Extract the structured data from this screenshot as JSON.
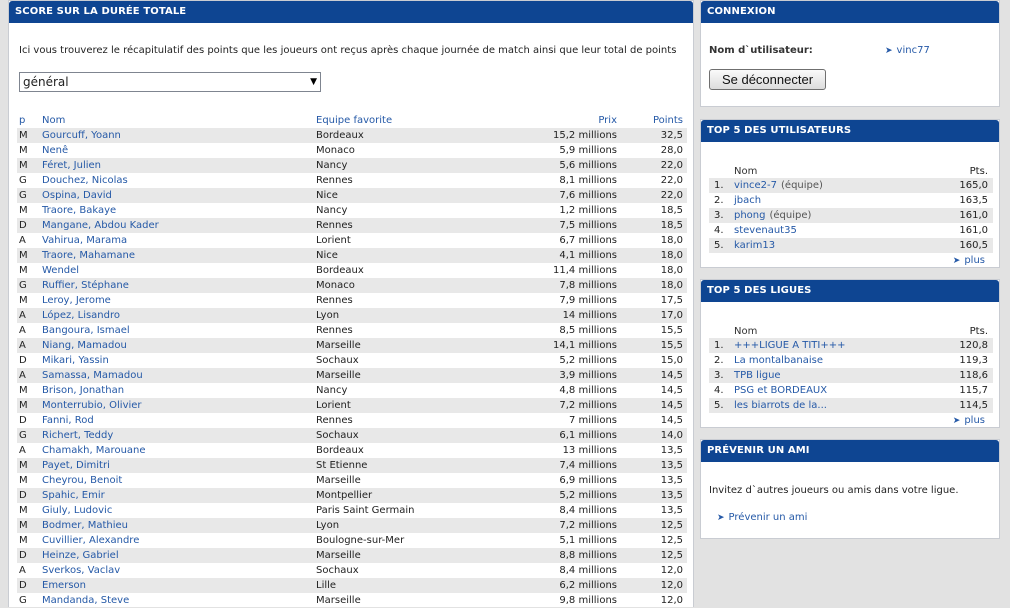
{
  "main": {
    "title": "SCORE SUR LA DURÉE TOTALE",
    "intro": "Ici vous trouverez le récapitulatif des points que les joueurs ont reçus après chaque journée de match ainsi que leur total de points",
    "select_value": "général",
    "columns": {
      "p": "p",
      "nom": "Nom",
      "equipe": "Equipe favorite",
      "prix": "Prix",
      "points": "Points"
    },
    "rows": [
      {
        "p": "M",
        "nom": "Gourcuff, Yoann",
        "equipe": "Bordeaux",
        "prix": "15,2 millions",
        "points": "32,5"
      },
      {
        "p": "M",
        "nom": "Nenê",
        "equipe": "Monaco",
        "prix": "5,9 millions",
        "points": "28,0"
      },
      {
        "p": "M",
        "nom": "Féret, Julien",
        "equipe": "Nancy",
        "prix": "5,6 millions",
        "points": "22,0"
      },
      {
        "p": "G",
        "nom": "Douchez, Nicolas",
        "equipe": "Rennes",
        "prix": "8,1 millions",
        "points": "22,0"
      },
      {
        "p": "G",
        "nom": "Ospina, David",
        "equipe": "Nice",
        "prix": "7,6 millions",
        "points": "22,0"
      },
      {
        "p": "M",
        "nom": "Traore, Bakaye",
        "equipe": "Nancy",
        "prix": "1,2 millions",
        "points": "18,5"
      },
      {
        "p": "D",
        "nom": "Mangane, Abdou Kader",
        "equipe": "Rennes",
        "prix": "7,5 millions",
        "points": "18,5"
      },
      {
        "p": "A",
        "nom": "Vahirua, Marama",
        "equipe": "Lorient",
        "prix": "6,7 millions",
        "points": "18,0"
      },
      {
        "p": "M",
        "nom": "Traore, Mahamane",
        "equipe": "Nice",
        "prix": "4,1 millions",
        "points": "18,0"
      },
      {
        "p": "M",
        "nom": "Wendel",
        "equipe": "Bordeaux",
        "prix": "11,4 millions",
        "points": "18,0"
      },
      {
        "p": "G",
        "nom": "Ruffier, Stéphane",
        "equipe": "Monaco",
        "prix": "7,8 millions",
        "points": "18,0"
      },
      {
        "p": "M",
        "nom": "Leroy, Jerome",
        "equipe": "Rennes",
        "prix": "7,9 millions",
        "points": "17,5"
      },
      {
        "p": "A",
        "nom": "López, Lisandro",
        "equipe": "Lyon",
        "prix": "14 millions",
        "points": "17,0"
      },
      {
        "p": "A",
        "nom": "Bangoura, Ismael",
        "equipe": "Rennes",
        "prix": "8,5 millions",
        "points": "15,5"
      },
      {
        "p": "A",
        "nom": "Niang, Mamadou",
        "equipe": "Marseille",
        "prix": "14,1 millions",
        "points": "15,5"
      },
      {
        "p": "D",
        "nom": "Mikari, Yassin",
        "equipe": "Sochaux",
        "prix": "5,2 millions",
        "points": "15,0"
      },
      {
        "p": "A",
        "nom": "Samassa, Mamadou",
        "equipe": "Marseille",
        "prix": "3,9 millions",
        "points": "14,5"
      },
      {
        "p": "M",
        "nom": "Brison, Jonathan",
        "equipe": "Nancy",
        "prix": "4,8 millions",
        "points": "14,5"
      },
      {
        "p": "M",
        "nom": "Monterrubio, Olivier",
        "equipe": "Lorient",
        "prix": "7,2 millions",
        "points": "14,5"
      },
      {
        "p": "D",
        "nom": "Fanni, Rod",
        "equipe": "Rennes",
        "prix": "7 millions",
        "points": "14,5"
      },
      {
        "p": "G",
        "nom": "Richert, Teddy",
        "equipe": "Sochaux",
        "prix": "6,1 millions",
        "points": "14,0"
      },
      {
        "p": "A",
        "nom": "Chamakh, Marouane",
        "equipe": "Bordeaux",
        "prix": "13 millions",
        "points": "13,5"
      },
      {
        "p": "M",
        "nom": "Payet, Dimitri",
        "equipe": "St Etienne",
        "prix": "7,4 millions",
        "points": "13,5"
      },
      {
        "p": "M",
        "nom": "Cheyrou, Benoit",
        "equipe": "Marseille",
        "prix": "6,9 millions",
        "points": "13,5"
      },
      {
        "p": "D",
        "nom": "Spahic, Emir",
        "equipe": "Montpellier",
        "prix": "5,2 millions",
        "points": "13,5"
      },
      {
        "p": "M",
        "nom": "Giuly, Ludovic",
        "equipe": "Paris Saint Germain",
        "prix": "8,4 millions",
        "points": "13,5"
      },
      {
        "p": "M",
        "nom": "Bodmer, Mathieu",
        "equipe": "Lyon",
        "prix": "7,2 millions",
        "points": "12,5"
      },
      {
        "p": "M",
        "nom": "Cuvillier, Alexandre",
        "equipe": "Boulogne-sur-Mer",
        "prix": "5,1 millions",
        "points": "12,5"
      },
      {
        "p": "D",
        "nom": "Heinze, Gabriel",
        "equipe": "Marseille",
        "prix": "8,8 millions",
        "points": "12,5"
      },
      {
        "p": "A",
        "nom": "Sverkos, Vaclav",
        "equipe": "Sochaux",
        "prix": "8,4 millions",
        "points": "12,0"
      },
      {
        "p": "D",
        "nom": "Emerson",
        "equipe": "Lille",
        "prix": "6,2 millions",
        "points": "12,0"
      },
      {
        "p": "G",
        "nom": "Mandanda, Steve",
        "equipe": "Marseille",
        "prix": "9,8 millions",
        "points": "12,0"
      }
    ]
  },
  "connexion": {
    "title": "CONNEXION",
    "user_label": "Nom d`utilisateur:",
    "username": "vinc77",
    "logout_label": "Se déconnecter"
  },
  "top_users": {
    "title": "TOP 5 DES UTILISATEURS",
    "col_name": "Nom",
    "col_pts": "Pts.",
    "rows": [
      {
        "rank": "1.",
        "name": "vince2-7",
        "extra": "(équipe)",
        "pts": "165,0"
      },
      {
        "rank": "2.",
        "name": "jbach",
        "extra": "",
        "pts": "163,5"
      },
      {
        "rank": "3.",
        "name": "phong",
        "extra": "(équipe)",
        "pts": "161,0"
      },
      {
        "rank": "4.",
        "name": "stevenaut35",
        "extra": "",
        "pts": "161,0"
      },
      {
        "rank": "5.",
        "name": "karim13",
        "extra": "",
        "pts": "160,5"
      }
    ],
    "more": "plus"
  },
  "top_leagues": {
    "title": "TOP 5 DES LIGUES",
    "col_name": "Nom",
    "col_pts": "Pts.",
    "rows": [
      {
        "rank": "1.",
        "name": "+++LIGUE A TITI+++",
        "extra": "",
        "pts": "120,8"
      },
      {
        "rank": "2.",
        "name": "La montalbanaise",
        "extra": "",
        "pts": "119,3"
      },
      {
        "rank": "3.",
        "name": "TPB ligue",
        "extra": "",
        "pts": "118,6"
      },
      {
        "rank": "4.",
        "name": "PSG et BORDEAUX",
        "extra": "",
        "pts": "115,7"
      },
      {
        "rank": "5.",
        "name": "les biarrots de la...",
        "extra": "",
        "pts": "114,5"
      }
    ],
    "more": "plus"
  },
  "prevenir": {
    "title": "PRÉVENIR UN AMI",
    "text": "Invitez d`autres joueurs ou amis dans votre ligue.",
    "link": "Prévenir un ami"
  },
  "colors": {
    "header": "#0e4592",
    "link": "#2559a7",
    "row_alt": "#e8e8e8"
  },
  "icons": {
    "link_chevron": "chevron-right-icon",
    "select_arrow": "chevron-down-icon"
  }
}
